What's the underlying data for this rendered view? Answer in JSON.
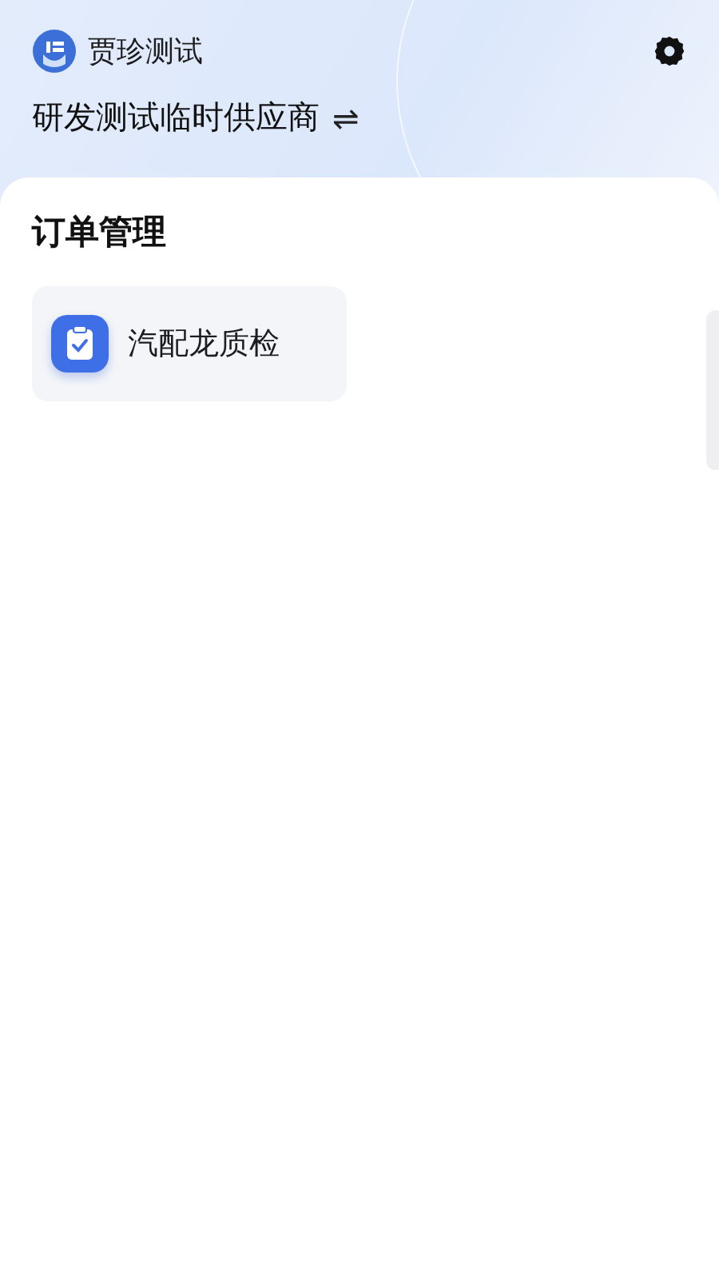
{
  "header": {
    "user_name": "贾珍测试",
    "company": "研发测试临时供应商",
    "switch_symbol": "⇌"
  },
  "section": {
    "title": "订单管理",
    "apps": [
      {
        "label": "汽配龙质检"
      }
    ]
  }
}
